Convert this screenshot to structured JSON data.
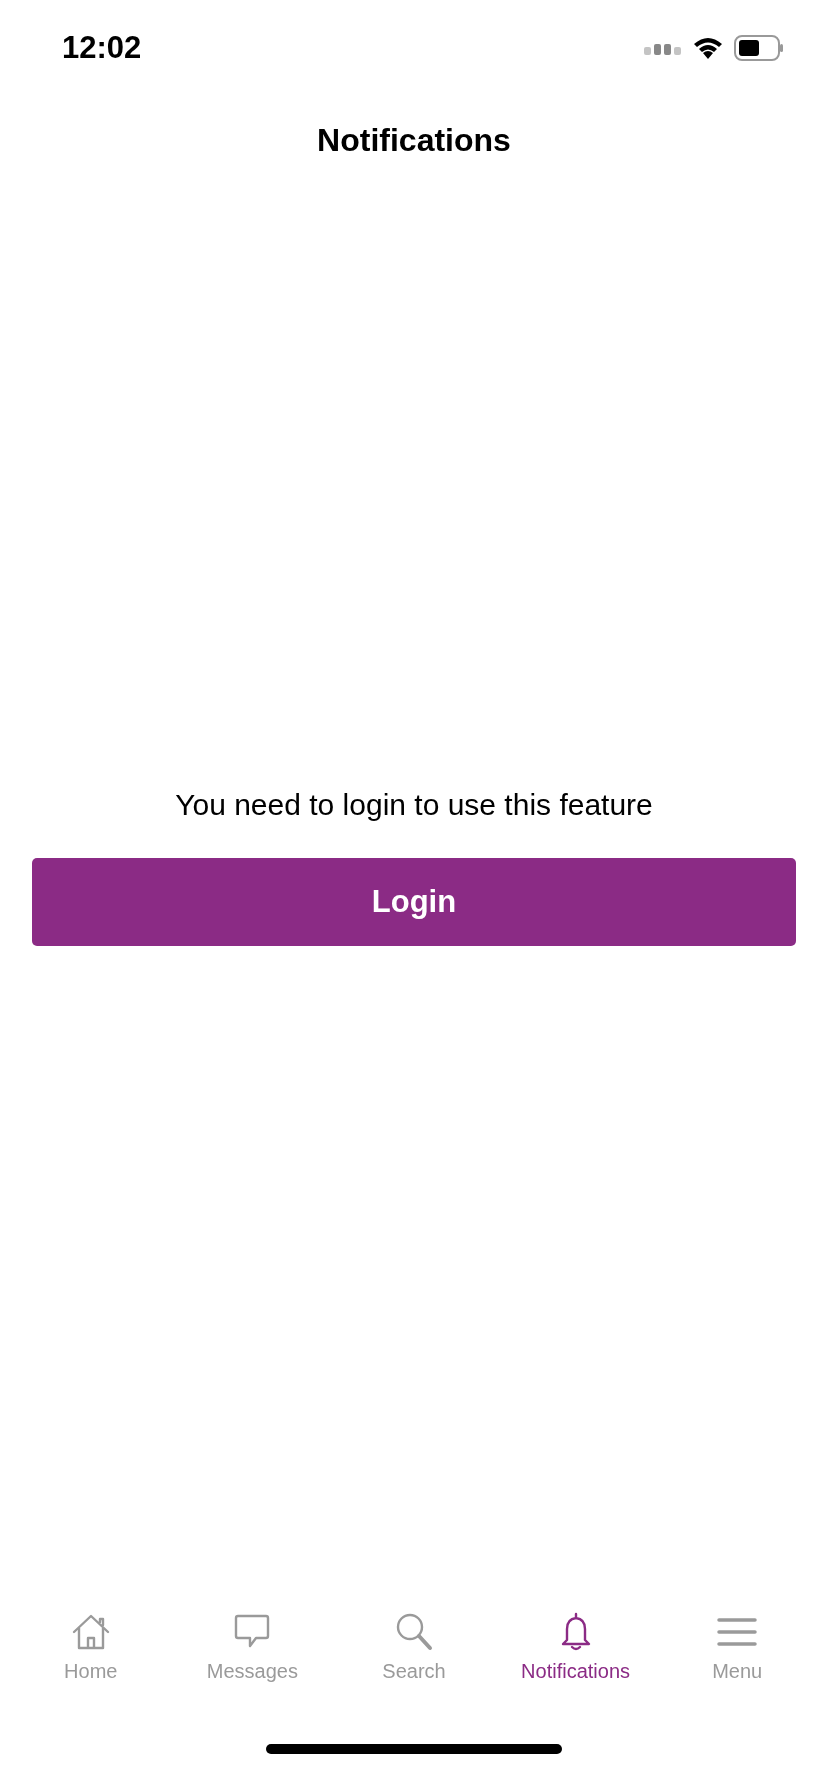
{
  "status_bar": {
    "time": "12:02"
  },
  "header": {
    "title": "Notifications"
  },
  "login_prompt": {
    "message": "You need to login to use this feature",
    "button": "Login"
  },
  "tab_bar": [
    {
      "label": "Home",
      "selected": false
    },
    {
      "label": "Messages",
      "selected": false
    },
    {
      "label": "Search",
      "selected": false
    },
    {
      "label": "Notifications",
      "selected": true
    },
    {
      "label": "Menu",
      "selected": false
    }
  ]
}
